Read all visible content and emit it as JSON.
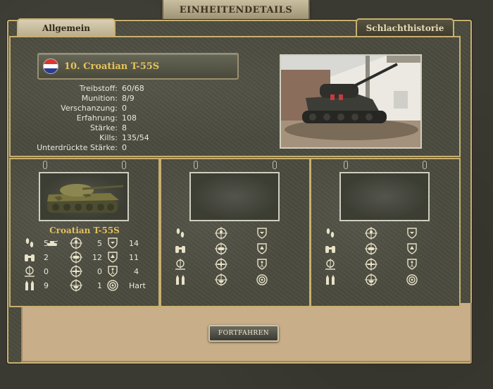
{
  "window": {
    "title": "EINHEITENDETAILS"
  },
  "tabs": [
    {
      "label": "Allgemein",
      "active": true
    },
    {
      "label": "Schlachthistorie",
      "active": false
    }
  ],
  "unit": {
    "name": "10. Croatian T-55S",
    "flag_colors": [
      "#e0342f",
      "#ffffff",
      "#2b3d8f"
    ],
    "stats": [
      {
        "label": "Treibstoff:",
        "value": "60/68"
      },
      {
        "label": "Munition:",
        "value": "8/9"
      },
      {
        "label": "Verschanzung:",
        "value": "0"
      },
      {
        "label": "Erfahrung:",
        "value": "108"
      },
      {
        "label": "Stärke:",
        "value": "8"
      },
      {
        "label": "Kills:",
        "value": "135/54"
      },
      {
        "label": "Unterdrückte Stärke:",
        "value": "0"
      }
    ]
  },
  "slots": [
    {
      "name": "Croatian T-55S",
      "filled": true,
      "rows": [
        {
          "icons": [
            "boots-icon",
            "soft-target-icon",
            "air-attack-icon"
          ],
          "values": [
            "5",
            "5",
            "14"
          ],
          "extra": "tank-small-icon"
        },
        {
          "icons": [
            "binoculars-icon",
            "hard-target-icon",
            "ground-defense-icon"
          ],
          "values": [
            "2",
            "12",
            "11"
          ]
        },
        {
          "icons": [
            "range-icon",
            "air-defense-icon",
            "close-defense-icon"
          ],
          "values": [
            "0",
            "0",
            "4"
          ]
        },
        {
          "icons": [
            "ammo-icon",
            "naval-attack-icon",
            "target-icon"
          ],
          "values": [
            "9",
            "1",
            "Hart"
          ]
        }
      ]
    },
    {
      "name": "",
      "filled": false
    },
    {
      "name": "",
      "filled": false
    }
  ],
  "buttons": {
    "continue": "FORTFAHREN"
  },
  "colors": {
    "gold": "#c8b070",
    "name_gold": "#e7c35c",
    "text": "#e8e8e0"
  }
}
